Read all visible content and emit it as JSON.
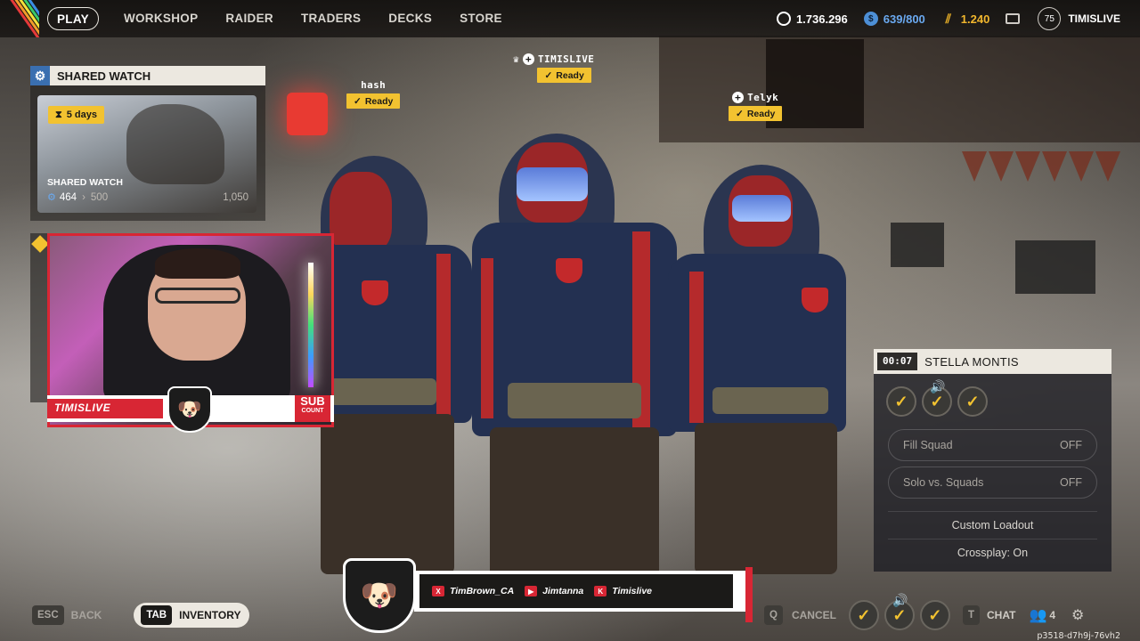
{
  "nav": {
    "items": [
      {
        "label": "PLAY",
        "active": true
      },
      {
        "label": "WORKSHOP",
        "active": false
      },
      {
        "label": "RAIDER",
        "active": false
      },
      {
        "label": "TRADERS",
        "active": false
      },
      {
        "label": "DECKS",
        "active": false
      },
      {
        "label": "STORE",
        "active": false
      }
    ]
  },
  "currencies": {
    "coins": "1.736.296",
    "raider_tokens": "639/800",
    "credits": "1.240"
  },
  "profile": {
    "level": "75",
    "username": "TIMISLIVE"
  },
  "shared_watch": {
    "header": "SHARED WATCH",
    "days": "5 days",
    "card_title": "SHARED WATCH",
    "progress_current": "464",
    "progress_next": "500",
    "progress_max": "1,050"
  },
  "players": [
    {
      "name": "hash",
      "status": "Ready"
    },
    {
      "name": "TIMISLIVE",
      "status": "Ready"
    },
    {
      "name": "Telyk",
      "status": "Ready"
    }
  ],
  "lobby": {
    "timer": "00:07",
    "map": "STELLA MONTIS",
    "fill_squad": {
      "label": "Fill Squad",
      "value": "OFF"
    },
    "solo_vs_squads": {
      "label": "Solo vs. Squads",
      "value": "OFF"
    },
    "custom_loadout": "Custom Loadout",
    "crossplay": "Crossplay: On"
  },
  "overlay": {
    "streamer_name": "TIMISLIVE",
    "sub_label": "SUB",
    "sub_sub": "COUNT",
    "socials": [
      {
        "platform": "x",
        "icon": "X",
        "handle": "TimBrown_CA"
      },
      {
        "platform": "youtube",
        "icon": "▶",
        "handle": "Jimtanna"
      },
      {
        "platform": "kick",
        "icon": "K",
        "handle": "Timislive"
      }
    ]
  },
  "bottom": {
    "esc_key": "ESC",
    "back_label": "BACK",
    "tab_key": "TAB",
    "inventory_label": "INVENTORY",
    "q_key": "Q",
    "cancel_label": "CANCEL",
    "t_key": "T",
    "chat_label": "CHAT",
    "party_count": "4",
    "version": "p3518-d7h9j-76vh2"
  },
  "colors": {
    "accent_yellow": "#f2c230",
    "overlay_red": "#d82634",
    "token_blue": "#4d8fd6"
  }
}
